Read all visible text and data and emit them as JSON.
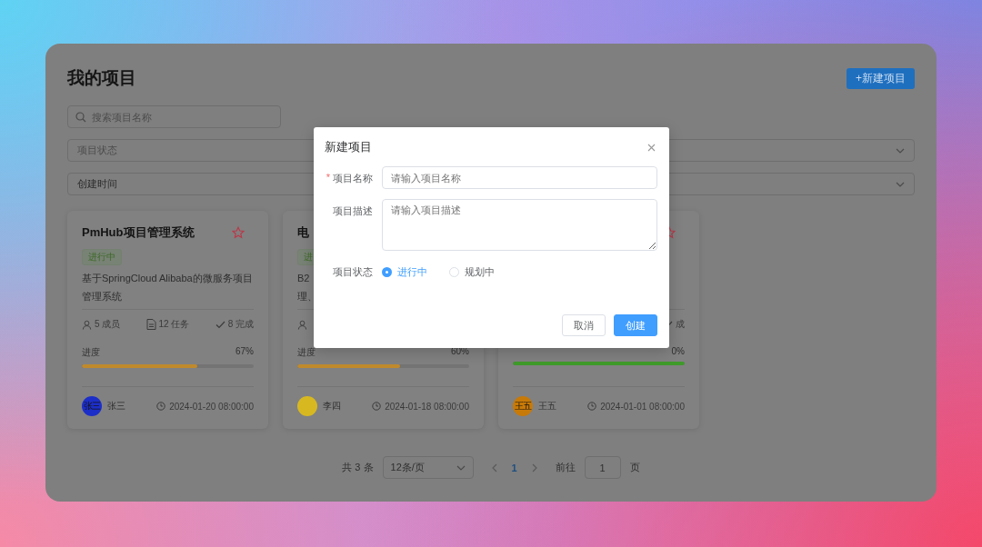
{
  "page": {
    "title": "我的项目",
    "new_button": "+新建项目"
  },
  "search": {
    "placeholder": "搜索项目名称"
  },
  "filters": [
    {
      "placeholder": "项目状态"
    },
    {
      "value": "创建时间"
    }
  ],
  "cards": [
    {
      "title": "PmHub项目管理系统",
      "favorite": false,
      "tag": "进行中",
      "description": "基于SpringCloud Alibaba的微服务项目管理系统",
      "stats": [
        {
          "kind": "members",
          "text": "5 成员"
        },
        {
          "kind": "tasks",
          "text": "12 任务"
        },
        {
          "kind": "done",
          "text": "8 完成"
        }
      ],
      "progress": {
        "label": "进度",
        "reading": "67%",
        "level": 0.67,
        "color": "#c08a2c"
      },
      "owner": {
        "name": "张三",
        "avatar_text": "张三",
        "color": "#1c2ec8"
      },
      "date": "2024-01-20 08:00:00"
    },
    {
      "title": "电",
      "tag": "进",
      "description": "B2\n理、",
      "stats": [
        {
          "kind": "members"
        }
      ],
      "progress": {
        "label": "进度",
        "reading": "60%",
        "level": 0.6,
        "color": "#c08a2c"
      },
      "owner": {
        "name": "李四",
        "color": "#d8b820"
      },
      "date": "2024-01-18 08:00:00"
    },
    {
      "favorite": false,
      "stats": [
        {
          "kind": "done",
          "text": "成"
        }
      ],
      "progress": {
        "reading": "0%",
        "level": 1,
        "color": "#3f9a2a"
      },
      "owner": {
        "name": "王五",
        "avatar_text": "王五",
        "color": "#c87a08"
      },
      "date": "2024-01-01 08:00:00"
    }
  ],
  "pagination": {
    "total": "共 3 条",
    "page_size": "12条/页",
    "pages": [
      {
        "label": "1",
        "selected": true
      }
    ],
    "goto_label": "前往",
    "goto_value": "1",
    "goto_suffix": "页"
  },
  "dialog": {
    "title": "新建项目",
    "fields": [
      {
        "kind": "input",
        "label": "项目名称",
        "marker": "*",
        "placeholder": "请输入项目名称"
      },
      {
        "kind": "textarea",
        "label": "项目描述",
        "placeholder": "请输入项目描述"
      },
      {
        "kind": "radio",
        "label": "项目状态",
        "options": [
          {
            "label": "进行中",
            "selected": true
          },
          {
            "label": "规划中",
            "selected": false
          }
        ]
      }
    ],
    "buttons": [
      {
        "kind": "default",
        "label": "取消"
      },
      {
        "kind": "primary",
        "label": "创建"
      }
    ]
  }
}
